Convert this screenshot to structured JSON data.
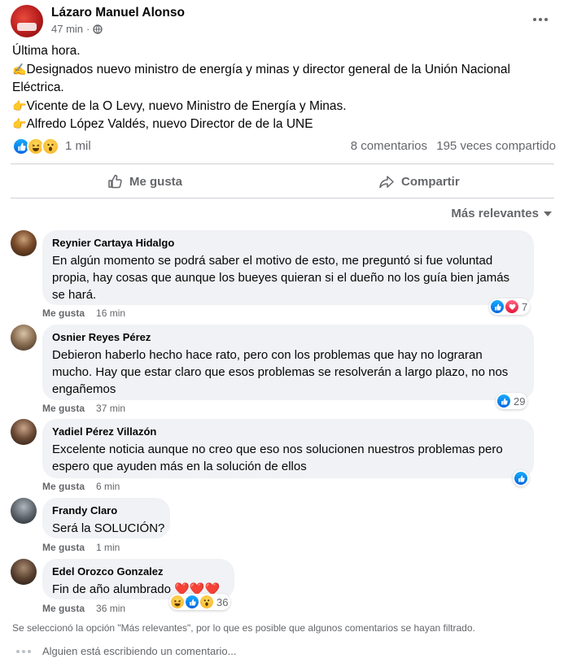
{
  "post": {
    "author": "Lázaro Manuel Alonso",
    "time": "47 min",
    "separator": "·",
    "lines": [
      {
        "emoji": "",
        "text": "Última hora."
      },
      {
        "emoji": "✍️",
        "text": "Designados nuevo ministro de energía y minas y director general de la Unión Nacional"
      },
      {
        "emoji": "",
        "text": "Eléctrica."
      },
      {
        "emoji": "👉",
        "text": "Vicente de la O Levy, nuevo Ministro de Energía y Minas."
      },
      {
        "emoji": "👉",
        "text": "Alfredo López Valdés, nuevo Director de de la UNE"
      }
    ],
    "reaction_count": "1 mil",
    "comment_count": "8 comentarios",
    "share_count": "195 veces compartido",
    "like_label": "Me gusta",
    "share_label": "Compartir",
    "sort_label": "Más relevantes"
  },
  "comments": [
    {
      "name": "Reynier Cartaya Hidalgo",
      "lines": [
        "En algún momento se podrá saber el motivo de esto, me preguntó si fue voluntad",
        "propia, hay cosas que aunque los bueyes quieran si el dueño no los guía bien jamás",
        "se hará."
      ],
      "like_label": "Me gusta",
      "time": "16 min",
      "reaction_count": "7"
    },
    {
      "name": "Osnier Reyes Pérez",
      "lines": [
        "Debieron haberlo hecho hace rato, pero con los problemas que hay no lograran",
        "mucho. Hay que estar claro que esos problemas se resolverán a largo plazo, no nos",
        "engañemos"
      ],
      "like_label": "Me gusta",
      "time": "37 min",
      "reaction_count": "29"
    },
    {
      "name": "Yadiel Pérez Villazón",
      "lines": [
        "Excelente noticia aunque no creo que eso nos solucionen nuestros problemas pero",
        "espero que ayuden más en la solución de ellos"
      ],
      "like_label": "Me gusta",
      "time": "6 min",
      "reaction_count": ""
    },
    {
      "name": "Frandy Claro",
      "lines": [
        "Será la SOLUCIÓN?"
      ],
      "like_label": "Me gusta",
      "time": "1 min",
      "reaction_count": ""
    },
    {
      "name": "Edel Orozco Gonzalez",
      "lines": [
        "Fin de año alumbrado"
      ],
      "hearts": "❤️❤️❤️",
      "like_label": "Me gusta",
      "time": "36 min",
      "reaction_count": "36"
    }
  ],
  "notice": "Se seleccionó la opción \"Más relevantes\", por lo que es posible que algunos comentarios se hayan filtrado.",
  "typing": "Alguien está escribiendo un comentario...",
  "colors": {
    "like_blue": "#1877f2",
    "muted": "#65676b",
    "bubble": "#f0f2f5"
  },
  "icons": [
    "globe-icon",
    "more-icon",
    "like-icon",
    "share-icon",
    "caret-down-icon"
  ]
}
